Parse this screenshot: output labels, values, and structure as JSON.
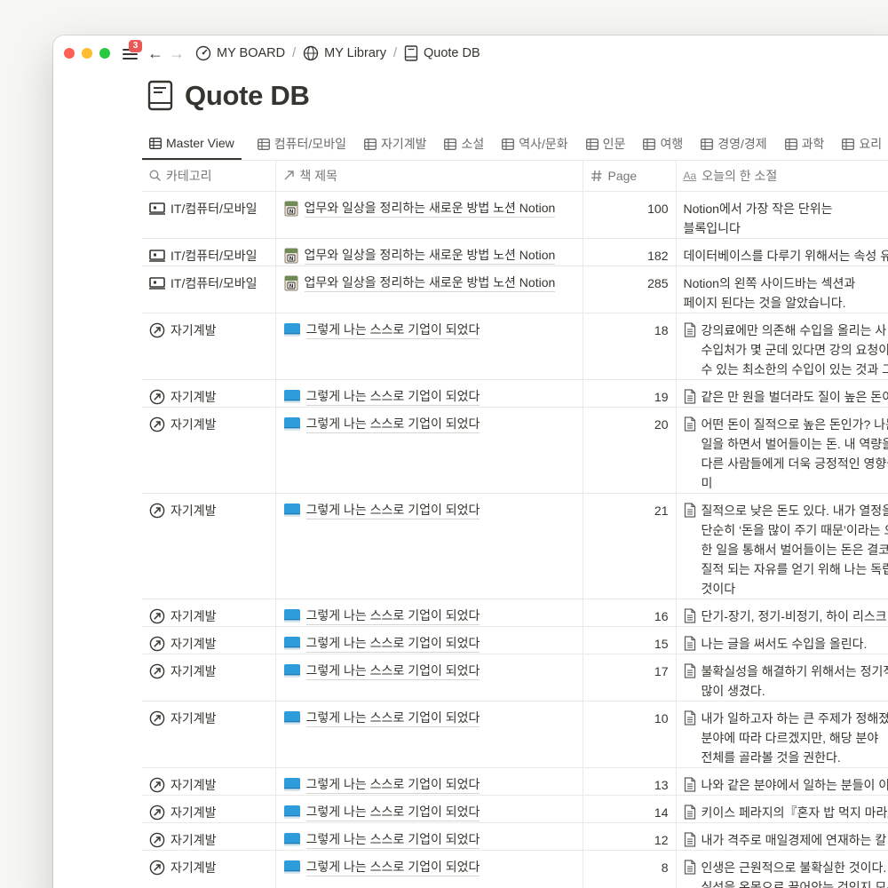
{
  "window": {
    "traffic_lights": [
      "#ff5f57",
      "#febc2e",
      "#28c840"
    ],
    "notification_count": "3"
  },
  "breadcrumb": [
    {
      "label": "MY BOARD",
      "icon": "gauge-icon"
    },
    {
      "label": "MY Library",
      "icon": "globe-icon"
    },
    {
      "label": "Quote DB",
      "icon": "book-icon"
    }
  ],
  "page": {
    "title": "Quote DB",
    "icon": "book-icon"
  },
  "tabs": [
    {
      "label": "Master View",
      "active": true
    },
    {
      "label": "컴퓨터/모바일"
    },
    {
      "label": "자기계발"
    },
    {
      "label": "소설"
    },
    {
      "label": "역사/문화"
    },
    {
      "label": "인문"
    },
    {
      "label": "여행"
    },
    {
      "label": "경영/경제"
    },
    {
      "label": "과학"
    },
    {
      "label": "요리"
    }
  ],
  "columns": [
    {
      "label": "카테고리",
      "icon": "search-icon"
    },
    {
      "label": "책 제목",
      "icon": "relation-arrow-icon"
    },
    {
      "label": "Page",
      "icon": "hash-icon"
    },
    {
      "label": "오늘의 한 소절",
      "icon": "text-aa-icon"
    }
  ],
  "rows": [
    {
      "category": "IT/컴퓨터/모바일",
      "cat_icon": "laptop",
      "book": "업무와 일상을 정리하는 새로운 방법 노션 Notion",
      "book_icon": "notion",
      "page": "100",
      "quote": "Notion에서 가장 작은 단위는 블록입니다",
      "doc": false
    },
    {
      "category": "IT/컴퓨터/모바일",
      "cat_icon": "laptop",
      "book": "업무와 일상을 정리하는 새로운 방법 노션 Notion",
      "book_icon": "notion",
      "page": "182",
      "quote": "데이터베이스를 다루기 위해서는 속성 유",
      "doc": false
    },
    {
      "category": "IT/컴퓨터/모바일",
      "cat_icon": "laptop",
      "book": "업무와 일상을 정리하는 새로운 방법 노션 Notion",
      "book_icon": "notion",
      "page": "285",
      "quote": "Notion의 왼쪽 사이드바는 섹션과 페이지 된다는 것을 알았습니다.",
      "doc": false
    },
    {
      "category": "자기계발",
      "cat_icon": "arrow",
      "book": "그렇게 나는 스스로 기업이 되었다",
      "book_icon": "blue",
      "page": "18",
      "quote": "강의료에만 의존해 수입을 올리는 사 인 수입처가 몇 군데 있다면 강의 요청이 할 수 있는 최소한의 수입이 있는 것과 그",
      "doc": true
    },
    {
      "category": "자기계발",
      "cat_icon": "arrow",
      "book": "그렇게 나는 스스로 기업이 되었다",
      "book_icon": "blue",
      "page": "19",
      "quote": "같은 만 원을 벌더라도 질이 높은 돈이",
      "doc": true
    },
    {
      "category": "자기계발",
      "cat_icon": "arrow",
      "book": "그렇게 나는 스스로 기업이 되었다",
      "book_icon": "blue",
      "page": "20",
      "quote": "어떤 돈이 질적으로 높은 돈인가? 나는 일을 하면서 벌어들이는 돈. 내 역량을 다른 사람들에게 더욱 긍정적인 영향을 미",
      "doc": true
    },
    {
      "category": "자기계발",
      "cat_icon": "arrow",
      "book": "그렇게 나는 스스로 기업이 되었다",
      "book_icon": "blue",
      "page": "21",
      "quote": "질적으로 낮은 돈도 있다. 내가 열정을 은 단순히 ‘돈을 많이 주기 때문’이라는 오 한 일을 통해서 벌어들이는 돈은 결코 질적 되는 자유를 얻기 위해 나는 독립한 것이다",
      "doc": true
    },
    {
      "category": "자기계발",
      "cat_icon": "arrow",
      "book": "그렇게 나는 스스로 기업이 되었다",
      "book_icon": "blue",
      "page": "16",
      "quote": "단기-장기, 정기-비정기, 하이 리스크",
      "doc": true
    },
    {
      "category": "자기계발",
      "cat_icon": "arrow",
      "book": "그렇게 나는 스스로 기업이 되었다",
      "book_icon": "blue",
      "page": "15",
      "quote": "나는 글을 써서도 수입을 올린다.",
      "doc": true
    },
    {
      "category": "자기계발",
      "cat_icon": "arrow",
      "book": "그렇게 나는 스스로 기업이 되었다",
      "book_icon": "blue",
      "page": "17",
      "quote": "불확실성을 해결하기 위해서는 정기적 많이 생겼다.",
      "doc": true
    },
    {
      "category": "자기계발",
      "cat_icon": "arrow",
      "book": "그렇게 나는 스스로 기업이 되었다",
      "book_icon": "blue",
      "page": "10",
      "quote": "내가 일하고자 하는 큰 주제가 정해졌 분야에 따라 다르겠지만, 해당 분야 전체를 골라볼 것을 권한다.",
      "doc": true
    },
    {
      "category": "자기계발",
      "cat_icon": "arrow",
      "book": "그렇게 나는 스스로 기업이 되었다",
      "book_icon": "blue",
      "page": "13",
      "quote": "나와 같은 분야에서 일하는 분들이 이",
      "doc": true
    },
    {
      "category": "자기계발",
      "cat_icon": "arrow",
      "book": "그렇게 나는 스스로 기업이 되었다",
      "book_icon": "blue",
      "page": "14",
      "quote": "키이스 페라지의『혼자 밥 먹지 마라』",
      "doc": true
    },
    {
      "category": "자기계발",
      "cat_icon": "arrow",
      "book": "그렇게 나는 스스로 기업이 되었다",
      "book_icon": "blue",
      "page": "12",
      "quote": "내가 격주로 매일경제에 연재하는 칼",
      "doc": true
    },
    {
      "category": "자기계발",
      "cat_icon": "arrow",
      "book": "그렇게 나는 스스로 기업이 되었다",
      "book_icon": "blue",
      "page": "8",
      "quote": "인생은 근원적으로 불확실한 것이다. 실성을 온몸으로 끌어안는 것인지 모른다",
      "doc": true
    }
  ]
}
